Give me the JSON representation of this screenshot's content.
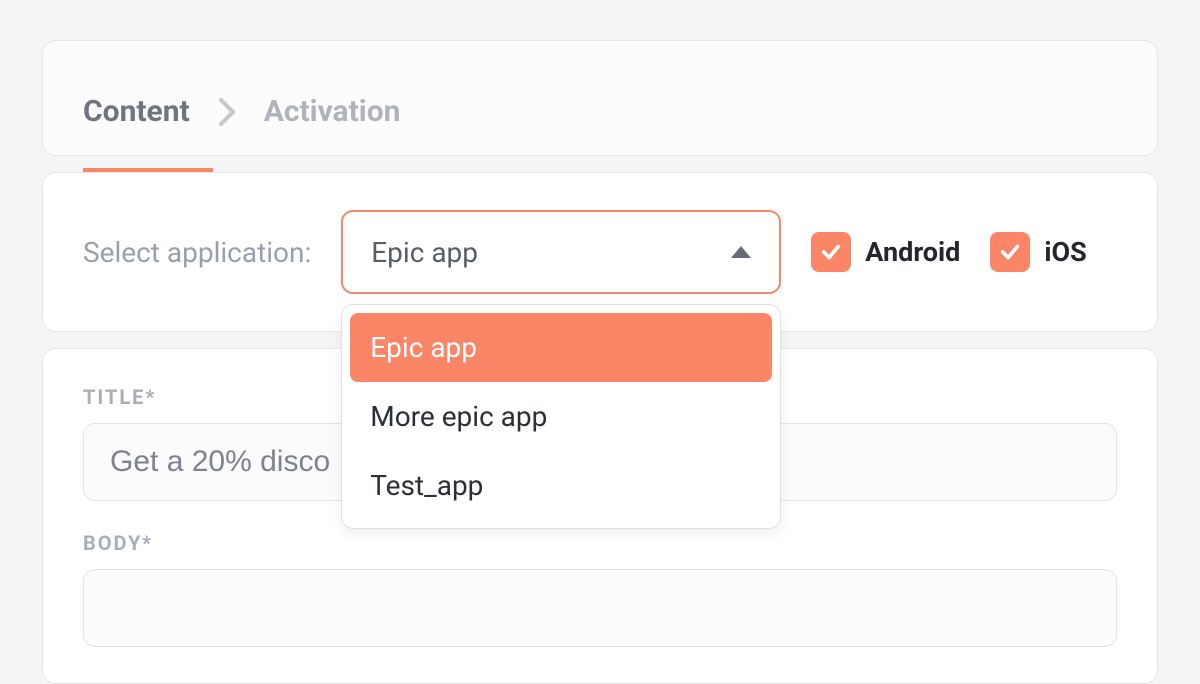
{
  "tabs": {
    "content": "Content",
    "activation": "Activation"
  },
  "appSection": {
    "label": "Select application:",
    "selected": "Epic app",
    "options": [
      "Epic app",
      "More epic app",
      "Test_app"
    ],
    "platforms": {
      "android": "Android",
      "ios": "iOS"
    }
  },
  "form": {
    "titleLabel": "TITLE*",
    "titleValue": "Get a 20% disco",
    "bodyLabel": "BODY*"
  },
  "colors": {
    "accent": "#fb8567"
  }
}
